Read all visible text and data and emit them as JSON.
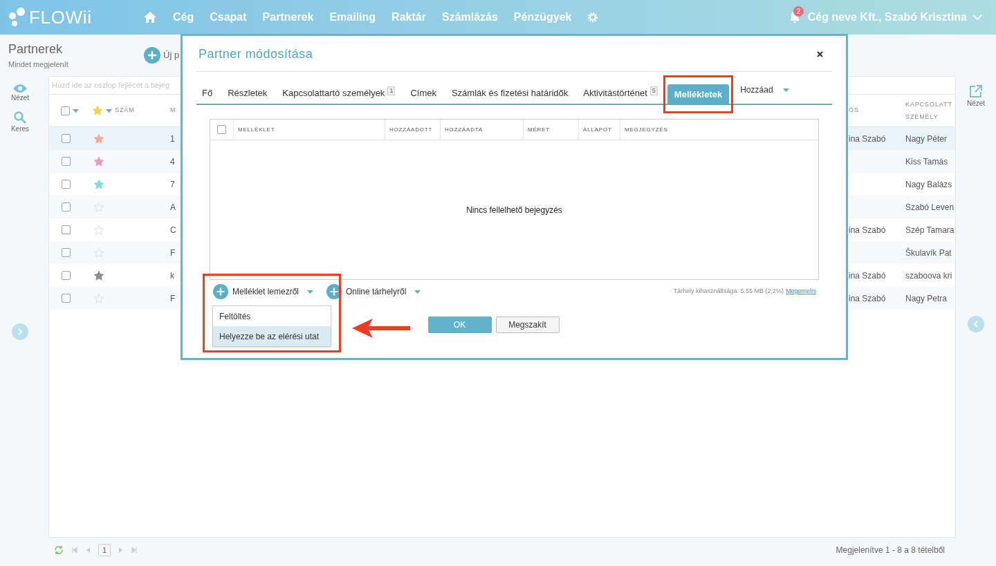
{
  "nav": {
    "logo": "FLOWii",
    "items": [
      "Cég",
      "Csapat",
      "Partnerek",
      "Emailing",
      "Raktár",
      "Számlázás",
      "Pénzügyek"
    ],
    "notifications": "2",
    "user": "Cég neve Kft., Szabó Krisztina"
  },
  "page": {
    "title": "Partnerek",
    "subtitle": "Mindet megjelenít",
    "new_button": "Új p"
  },
  "left_tools": [
    "Nézet",
    "Keres"
  ],
  "right_tools": [
    "Nézet"
  ],
  "grid": {
    "group_hint": "Húzd ide az oszlop fejlécét a bejeg",
    "all_checked": false,
    "columns": [
      "SZÁM",
      "M",
      "ÓS",
      "KAPCSOLATT SZEMÉLY"
    ],
    "rows": [
      {
        "selected": true,
        "starred": true,
        "color": "#f4a98c",
        "column_2": "1",
        "column_3": "ina Szabó",
        "contact": "Nagy Péter"
      },
      {
        "selected": false,
        "starred": true,
        "color": "#e79ac9",
        "column_2": "4",
        "contact": "Kiss Tamás"
      },
      {
        "selected": false,
        "starred": true,
        "color": "#7fdcd6",
        "column_2": "7",
        "contact": "Nagy Balázs"
      },
      {
        "selected": false,
        "starred": false,
        "column_2": "A",
        "contact": "Szabó Leven"
      },
      {
        "selected": false,
        "starred": false,
        "column_2": "C",
        "column_3": "ina Szabó",
        "contact": "Szép Tamara"
      },
      {
        "selected": false,
        "starred": false,
        "column_2": "F",
        "contact": "Škulavík Pat"
      },
      {
        "selected": false,
        "starred": true,
        "color": "#8e8e8e",
        "column_2": "k",
        "column_3": "ina Szabó",
        "contact": "szaboova kri"
      },
      {
        "selected": false,
        "starred": false,
        "column_2": "F",
        "column_3": "ina Szabó",
        "contact": "Nagy Petra"
      }
    ],
    "pager": {
      "page": "1",
      "summary": "Megjelenítve 1 - 8 a 8 tételből"
    }
  },
  "modal": {
    "title": "Partner módosítása",
    "tabs": [
      {
        "label": "Fő",
        "selected": false
      },
      {
        "label": "Részletek",
        "selected": false
      },
      {
        "label": "Kapcsolattartó személyek",
        "badge": "1",
        "selected": false
      },
      {
        "label": "Címek",
        "selected": false
      },
      {
        "label": "Számlák és fizetési határidők",
        "selected": false
      },
      {
        "label": "Aktivitástörténet",
        "badge": "5",
        "selected": false
      },
      {
        "label": "Mellékletek",
        "selected": true,
        "highlighted": true
      }
    ],
    "add_button": "Hozzáad",
    "all_checked": false,
    "columns": [
      "MELLÉKLET",
      "HOZZÁADOTT",
      "HOZZÁADTA",
      "MÉRET",
      "ÁLLAPOT",
      "MEGJEGYZÉS"
    ],
    "empty_message": "Nincs fellelhető bejegyzés",
    "upload_menu": {
      "label": "Melléklet lemezről",
      "expanded": true,
      "highlighted": true,
      "items": [
        {
          "label": "Feltöltés",
          "selected": false
        },
        {
          "label": "Helyezze be az elérési utat",
          "selected": true
        }
      ]
    },
    "online_button": "Online tárhelyről",
    "storage": "Tárhely kihasználtsága: 5,55 MB (2,2%)",
    "storage_link": "Megemelni",
    "ok": "OK",
    "cancel": "Megszakít"
  }
}
